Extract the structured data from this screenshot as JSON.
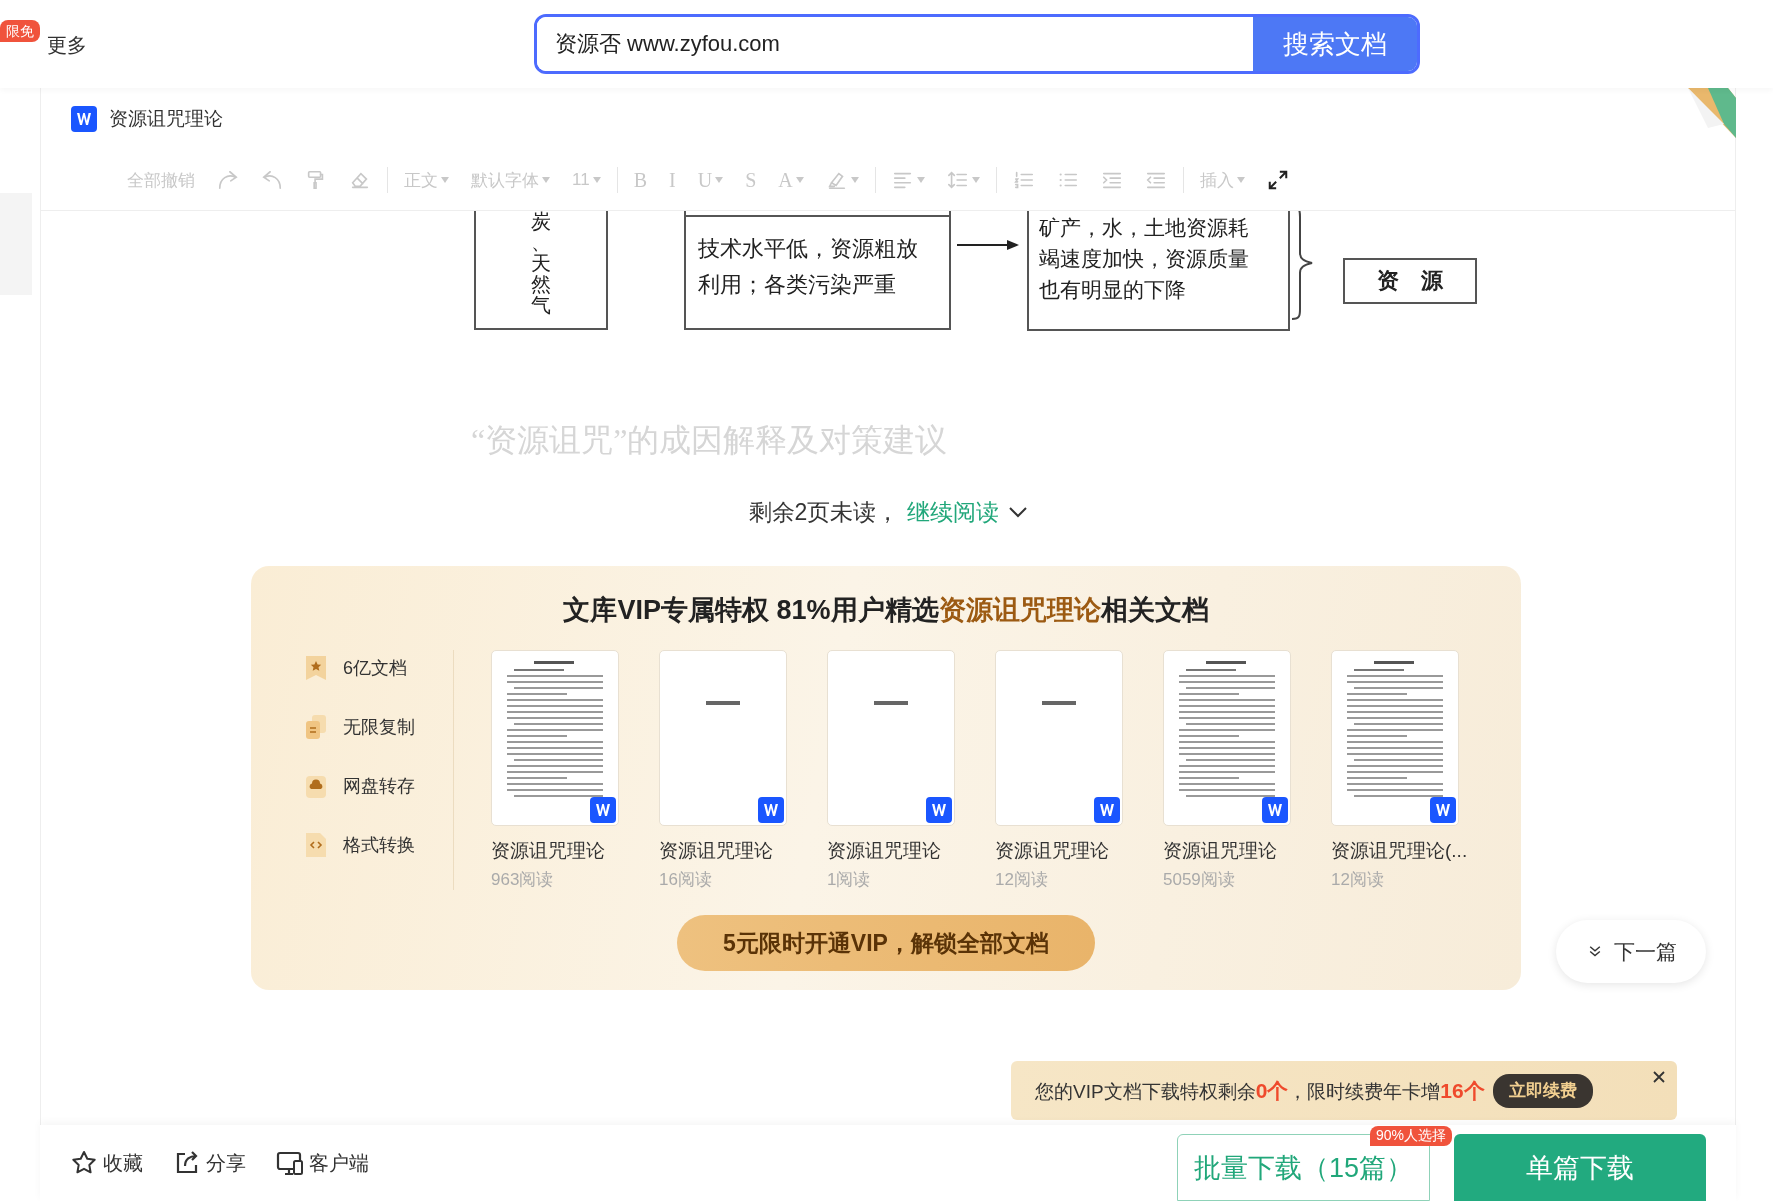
{
  "header": {
    "badge": "限免",
    "more": "更多",
    "search": {
      "value": "资源否 www.zyfou.com",
      "button": "搜索文档"
    }
  },
  "document": {
    "title": "资源诅咒理论",
    "toolbar": [
      [
        {
          "kind": "text",
          "label": "全部撤销",
          "dropdown": false,
          "disabled": true
        },
        {
          "kind": "icon",
          "dropdown": false,
          "disabled": true
        },
        {
          "kind": "icon",
          "dropdown": false,
          "disabled": true
        },
        {
          "kind": "icon",
          "dropdown": false,
          "disabled": true
        },
        {
          "kind": "icon",
          "dropdown": false,
          "disabled": true
        }
      ],
      [
        {
          "kind": "text",
          "label": "正文",
          "dropdown": true,
          "disabled": true
        },
        {
          "kind": "text",
          "label": "默认字体",
          "dropdown": true,
          "disabled": true
        },
        {
          "kind": "text",
          "label": "11",
          "dropdown": true,
          "disabled": true
        }
      ],
      [
        {
          "kind": "letter",
          "label": "B",
          "dropdown": false,
          "disabled": true
        },
        {
          "kind": "letter",
          "label": "I",
          "dropdown": false,
          "disabled": true
        },
        {
          "kind": "letter",
          "label": "U",
          "dropdown": true,
          "disabled": true
        },
        {
          "kind": "letter",
          "label": "S",
          "dropdown": false,
          "disabled": true
        },
        {
          "kind": "letter",
          "label": "A",
          "dropdown": true,
          "disabled": true
        },
        {
          "kind": "icon",
          "dropdown": true,
          "disabled": true
        }
      ],
      [
        {
          "kind": "icon",
          "dropdown": true,
          "disabled": true
        },
        {
          "kind": "icon",
          "dropdown": true,
          "disabled": true
        }
      ],
      [
        {
          "kind": "icon",
          "dropdown": false,
          "disabled": true
        },
        {
          "kind": "icon",
          "dropdown": false,
          "disabled": true
        },
        {
          "kind": "icon",
          "dropdown": false,
          "disabled": true
        },
        {
          "kind": "icon",
          "dropdown": false,
          "disabled": true
        }
      ],
      [
        {
          "kind": "text",
          "label": "插入",
          "dropdown": true,
          "disabled": true
        },
        {
          "kind": "icon",
          "dropdown": false,
          "disabled": false
        }
      ]
    ],
    "flowchart": {
      "column_text": "炭、天然气",
      "cause": "技术水平低，资源粗放利用；各类污染严重",
      "effect": "矿产，水，土地资源耗竭速度加快，资源质量也有明显的下降",
      "result": "资　源"
    },
    "next_heading": "“资源诅咒”的成因解释及对策建议"
  },
  "read_more": {
    "remaining": "剩余2页未读，",
    "link": "继续阅读"
  },
  "vip_panel": {
    "title_before": "文库VIP专属特权 81%用户精选",
    "title_highlight": "资源诅咒理论",
    "title_after": "相关文档",
    "features": [
      "6亿文档",
      "无限复制",
      "网盘转存",
      "格式转换"
    ],
    "documents": [
      {
        "title": "资源诅咒理论",
        "reads": "963阅读",
        "kind": "dense"
      },
      {
        "title": "资源诅咒理论",
        "reads": "16阅读",
        "kind": "sparse"
      },
      {
        "title": "资源诅咒理论",
        "reads": "1阅读",
        "kind": "sparse"
      },
      {
        "title": "资源诅咒理论",
        "reads": "12阅读",
        "kind": "sparse"
      },
      {
        "title": "资源诅咒理论",
        "reads": "5059阅读",
        "kind": "dense"
      },
      {
        "title": "资源诅咒理论(...",
        "reads": "12阅读",
        "kind": "dense"
      }
    ],
    "cta": "5元限时开通VIP，解锁全部文档"
  },
  "next_button": "下一篇",
  "notice": {
    "text_before": "您的VIP文档下载特权剩余",
    "count": "0个",
    "text_middle": "，限时续费年卡增",
    "bonus": "16个",
    "button": "立即续费"
  },
  "bottom_bar": {
    "actions": [
      "收藏",
      "分享",
      "客户端"
    ],
    "batch_download": "批量下载（15篇）",
    "badge": "90%人选择",
    "single_download": "单篇下载"
  }
}
